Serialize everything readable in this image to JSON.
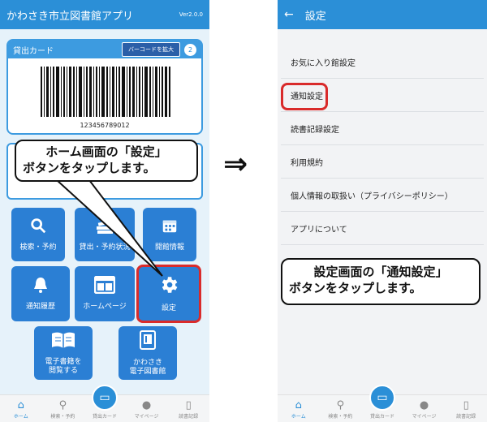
{
  "left": {
    "app_title": "かわさき市立図書館アプリ",
    "version": "Ver2.0.0",
    "card_label": "貸出カード",
    "barcode_button": "バーコードを拡大",
    "card_count": "2",
    "barcode_number": "123456789012",
    "tiles": [
      {
        "label": "検索・予約",
        "icon": "search-icon"
      },
      {
        "label": "貸出・予約状況",
        "icon": "books-icon"
      },
      {
        "label": "開館情報",
        "icon": "calendar-icon"
      },
      {
        "label": "通知履歴",
        "icon": "bell-icon"
      },
      {
        "label": "ホームページ",
        "icon": "browser-icon"
      },
      {
        "label": "設定",
        "icon": "gear-icon"
      },
      {
        "label": "電子書籍を\n閲覧する",
        "icon": "open-book-icon"
      },
      {
        "label": "かわさき\n電子図書館",
        "icon": "tablet-book-icon"
      }
    ],
    "nav": [
      {
        "label": "ホーム",
        "icon": "home-icon"
      },
      {
        "label": "検索・予約",
        "icon": "search-icon"
      },
      {
        "label": "貸出カード",
        "icon": "card-icon"
      },
      {
        "label": "マイページ",
        "icon": "person-icon"
      },
      {
        "label": "読書記録",
        "icon": "book-record-icon"
      }
    ],
    "callout_line1": "ホーム画面の「設定」",
    "callout_line2": "ボタンをタップします。"
  },
  "arrow": "⇒",
  "right": {
    "title": "設定",
    "items": [
      "お気に入り館設定",
      "通知設定",
      "読書記録設定",
      "利用規約",
      "個人情報の取扱い（プライバシーポリシー）",
      "アプリについて"
    ],
    "nav": [
      {
        "label": "ホーム",
        "icon": "home-icon"
      },
      {
        "label": "検索・予約",
        "icon": "search-icon"
      },
      {
        "label": "貸出カード",
        "icon": "card-icon"
      },
      {
        "label": "マイページ",
        "icon": "person-icon"
      },
      {
        "label": "読書記録",
        "icon": "book-record-icon"
      }
    ],
    "callout_line1": "設定画面の「通知設定」",
    "callout_line2": "ボタンをタップします。"
  },
  "colors": {
    "primary": "#2b8fd7",
    "tile": "#2b7fd4",
    "highlight": "#d92b2b"
  }
}
